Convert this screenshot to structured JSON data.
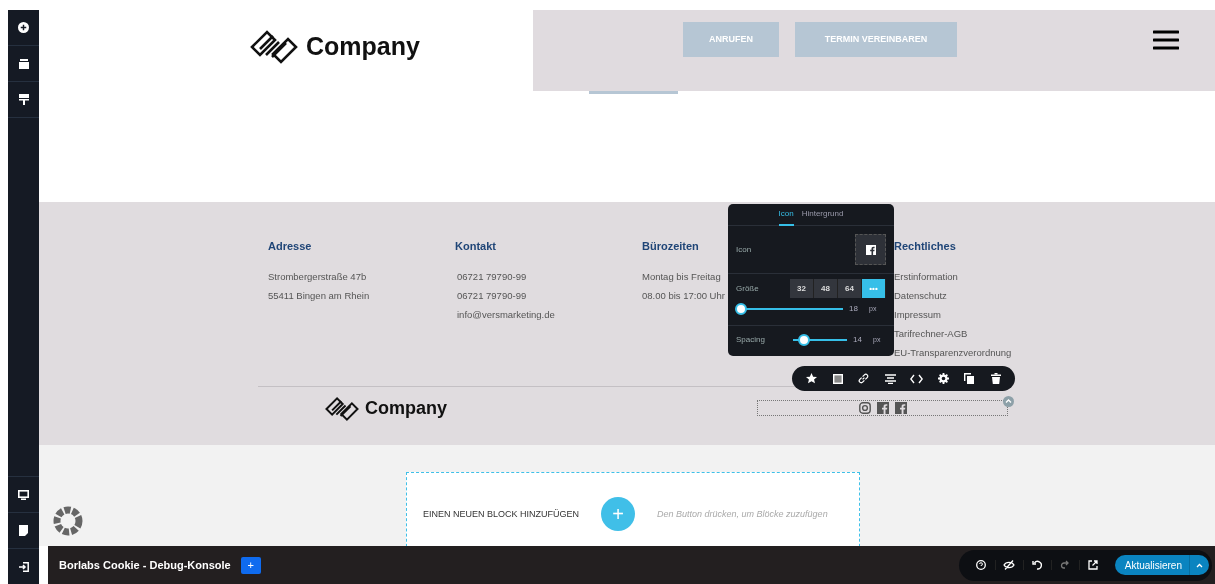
{
  "header": {
    "logo_text": "Company",
    "buttons": [
      "ANRUFEN",
      "TERMIN VEREINBAREN"
    ]
  },
  "footer": {
    "columns": [
      {
        "heading": "Adresse",
        "lines": [
          "Strombergerstraße 47b",
          "55411 Bingen am Rhein"
        ]
      },
      {
        "heading": "Kontakt",
        "lines": [
          "06721 79790-99",
          "06721 79790-99",
          "info@versmarketing.de"
        ]
      },
      {
        "heading": "Bürozeiten",
        "lines": [
          "Montag bis Freitag",
          "08.00 bis 17:00 Uhr"
        ]
      },
      {
        "heading": "Rechtliches",
        "lines": [
          "Erstinformation",
          "Datenschutz",
          "Impressum",
          "Tarifrechner-AGB",
          "EU-Transparenzverordnung"
        ]
      }
    ],
    "logo_text": "Company"
  },
  "popover": {
    "tabs": [
      {
        "label": "Icon",
        "selected": true
      },
      {
        "label": "Hintergrund",
        "selected": false
      }
    ],
    "icon_label": "Icon",
    "size_label": "Größe",
    "size_options": [
      {
        "label": "32",
        "selected": false
      },
      {
        "label": "48",
        "selected": false
      },
      {
        "label": "64",
        "selected": false
      },
      {
        "label": "•••",
        "selected": true
      }
    ],
    "size_slider": {
      "level": 0.05,
      "value": "18",
      "unit": "px"
    },
    "spacing_label": "Spacing",
    "spacing_slider": {
      "level": 0.2,
      "value": "14",
      "unit": "px"
    }
  },
  "add_block": {
    "title": "EINEN NEUEN BLOCK HINZUFÜGEN",
    "button": "+",
    "hint": "Den Button drücken, um Blöcke zuzufügen"
  },
  "debug_bar": {
    "title": "Borlabs Cookie - Debug-Konsole",
    "plus_button": "+",
    "update_button": "Aktualisieren"
  }
}
